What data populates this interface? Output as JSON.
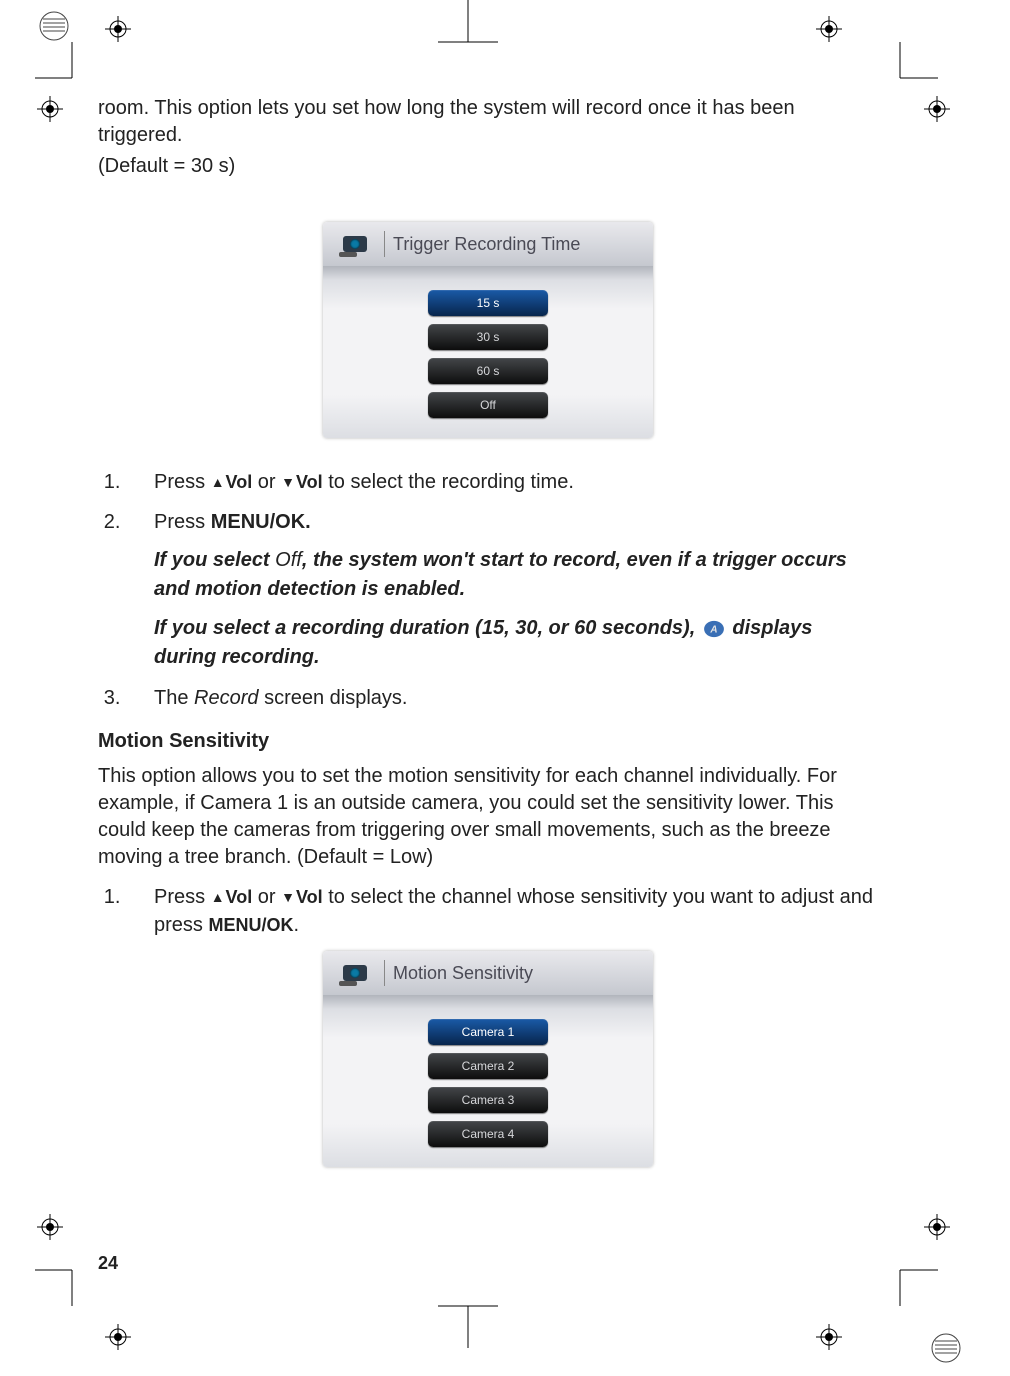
{
  "intro": {
    "line1": "room. This option lets you set how long the system will record once it has been triggered.",
    "line2": "(Default = 30 s)"
  },
  "figure1": {
    "title": "Trigger Recording Time",
    "options": [
      "15 s",
      "30 s",
      "60 s",
      "Off"
    ],
    "selected_index": 0
  },
  "steps1": {
    "s1_a": "Press ",
    "s1_vol_up": "Vol",
    "s1_or": " or ",
    "s1_vol_dn": "Vol",
    "s1_b": " to select the recording time.",
    "s2_a": "Press ",
    "s2_b": "MENU/OK.",
    "note1_a": "If you select ",
    "note1_off": "Off",
    "note1_b": ", the system won't start to record, even if a trigger occurs and motion detection is enabled.",
    "note2_a": "If you select a recording duration (15, 30, or 60 seconds), ",
    "note2_b": " displays during recording.",
    "s3_a": "The ",
    "s3_rec": "Record",
    "s3_b": " screen displays."
  },
  "section2": {
    "heading": "Motion Sensitivity",
    "body": "This option allows you to set the motion sensitivity for each channel individually. For example, if Camera 1 is an outside camera, you could set the sensitivity lower. This could keep the cameras from triggering over small movements, such as the breeze moving a tree branch.  (Default = Low)"
  },
  "steps2": {
    "s1_a": "Press ",
    "s1_vol_up": "Vol",
    "s1_or": " or ",
    "s1_vol_dn": "Vol",
    "s1_b": " to select the channel whose sensitivity you want to adjust and press ",
    "s1_c": "MENU/OK",
    "s1_d": "."
  },
  "figure2": {
    "title": "Motion Sensitivity",
    "options": [
      "Camera  1",
      "Camera  2",
      "Camera  3",
      "Camera  4"
    ],
    "selected_index": 0
  },
  "page_number": "24"
}
